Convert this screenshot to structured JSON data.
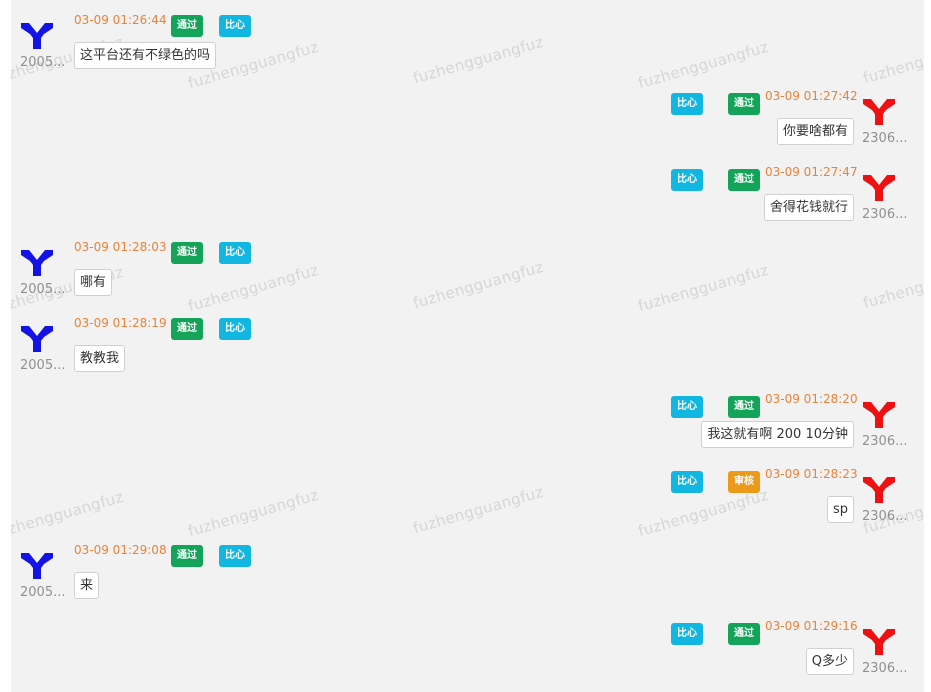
{
  "watermark": "fuzhengguangfuz",
  "colors": {
    "user_a_icon": "#1313e6",
    "user_b_icon": "#ee1111"
  },
  "messages": [
    {
      "side": "left",
      "user": "2005...",
      "time": "03-09 01:26:44",
      "status": "通过",
      "status_type": "pass",
      "action": "比心",
      "text": "这平台还有不绿色的吗"
    },
    {
      "side": "right",
      "user": "2306...",
      "time": "03-09 01:27:42",
      "status": "通过",
      "status_type": "pass",
      "action": "比心",
      "text": "你要啥都有"
    },
    {
      "side": "right",
      "user": "2306...",
      "time": "03-09 01:27:47",
      "status": "通过",
      "status_type": "pass",
      "action": "比心",
      "text": "舍得花钱就行"
    },
    {
      "side": "left",
      "user": "2005...",
      "time": "03-09 01:28:03",
      "status": "通过",
      "status_type": "pass",
      "action": "比心",
      "text": "哪有"
    },
    {
      "side": "left",
      "user": "2005...",
      "time": "03-09 01:28:19",
      "status": "通过",
      "status_type": "pass",
      "action": "比心",
      "text": "教教我"
    },
    {
      "side": "right",
      "user": "2306...",
      "time": "03-09 01:28:20",
      "status": "通过",
      "status_type": "pass",
      "action": "比心",
      "text": "我这就有啊 200 10分钟"
    },
    {
      "side": "right",
      "user": "2306...",
      "time": "03-09 01:28:23",
      "status": "审核",
      "status_type": "pending",
      "action": "比心",
      "text": "sp"
    },
    {
      "side": "left",
      "user": "2005...",
      "time": "03-09 01:29:08",
      "status": "通过",
      "status_type": "pass",
      "action": "比心",
      "text": "来"
    },
    {
      "side": "right",
      "user": "2306...",
      "time": "03-09 01:29:16",
      "status": "通过",
      "status_type": "pass",
      "action": "比心",
      "text": "Q多少"
    }
  ]
}
